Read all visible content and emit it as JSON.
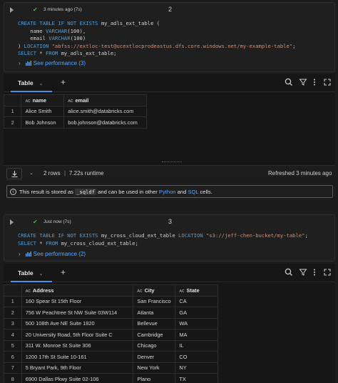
{
  "cell2": {
    "status": "3 minutes ago (7s)",
    "number": "2",
    "code_lines": [
      [
        [
          "kw",
          "CREATE TABLE IF NOT EXISTS "
        ],
        [
          "tx",
          "my_adls_ext_table ("
        ]
      ],
      [
        [
          "tx",
          "    name "
        ],
        [
          "kw",
          "VARCHAR"
        ],
        [
          "tx",
          "(100),"
        ]
      ],
      [
        [
          "tx",
          "    email "
        ],
        [
          "kw",
          "VARCHAR"
        ],
        [
          "tx",
          "(100)"
        ]
      ],
      [
        [
          "tx",
          ") "
        ],
        [
          "kw",
          "LOCATION "
        ],
        [
          "str",
          "\"abfss://extloc-test@ucextlocprodeastus.dfs.core.windows.net/my-example-table\""
        ],
        [
          "tx",
          ";"
        ]
      ],
      [
        [
          "kw",
          "SELECT "
        ],
        [
          "tx",
          "* "
        ],
        [
          "kw",
          "FROM "
        ],
        [
          "tx",
          "my_adls_ext_table;"
        ]
      ]
    ],
    "perf_label": "See performance (3)",
    "tab_label": "Table",
    "columns": [
      "name",
      "email"
    ],
    "rows": [
      [
        "1",
        "Alice Smith",
        "alice.smith@databricks.com"
      ],
      [
        "2",
        "Bob Johnson",
        "bob.johnson@databricks.com"
      ]
    ],
    "footer": {
      "rows_text": "2 rows",
      "runtime_text": "7.22s runtime",
      "refreshed_text": "Refreshed 3 minutes ago"
    },
    "note": {
      "prefix": "This result is stored as ",
      "code": "_sqldf",
      "middle": " and can be used in other ",
      "link1": "Python",
      "and": " and ",
      "link2": "SQL",
      "suffix": " cells."
    }
  },
  "cell3": {
    "status": "Just now (7s)",
    "number": "3",
    "code_lines": [
      [
        [
          "kw",
          "CREATE TABLE IF NOT EXISTS "
        ],
        [
          "tx",
          "my_cross_cloud_ext_table "
        ],
        [
          "kw",
          "LOCATION "
        ],
        [
          "str",
          "\"s3://jeff-chen-bucket/my-table\""
        ],
        [
          "tx",
          ";"
        ]
      ],
      [
        [
          "kw",
          "SELECT "
        ],
        [
          "tx",
          "* "
        ],
        [
          "kw",
          "FROM "
        ],
        [
          "tx",
          "my_cross_cloud_ext_table;"
        ]
      ]
    ],
    "perf_label": "See performance (2)",
    "tab_label": "Table",
    "columns": [
      "Address",
      "City",
      "State"
    ],
    "rows": [
      [
        "1",
        "160 Spear St 15th Floor",
        "San Francisco",
        "CA"
      ],
      [
        "2",
        "756 W Peachtree St NW Suite 03W114",
        "Atlanta",
        "GA"
      ],
      [
        "3",
        "500 108th Ave NE Suite 1820",
        "Bellevue",
        "WA"
      ],
      [
        "4",
        "20 University Road, 5th Floor Suite C",
        "Cambridge",
        "MA"
      ],
      [
        "5",
        "311 W. Monroe St Suite 306",
        "Chicago",
        "IL"
      ],
      [
        "6",
        "1200 17th St Suite 10-161",
        "Denver",
        "CO"
      ],
      [
        "7",
        "5 Bryant Park, 9th Floor",
        "New York",
        "NY"
      ],
      [
        "8",
        "6900 Dallas Pkwy Suite 02-106",
        "Plano",
        "TX"
      ]
    ]
  },
  "colors": {
    "background": "#1c1c1c",
    "keyword": "#569cd6",
    "string": "#ce9178",
    "link": "#58a6ff",
    "success": "#3fb950",
    "tab_underline": "#4a90e2"
  }
}
